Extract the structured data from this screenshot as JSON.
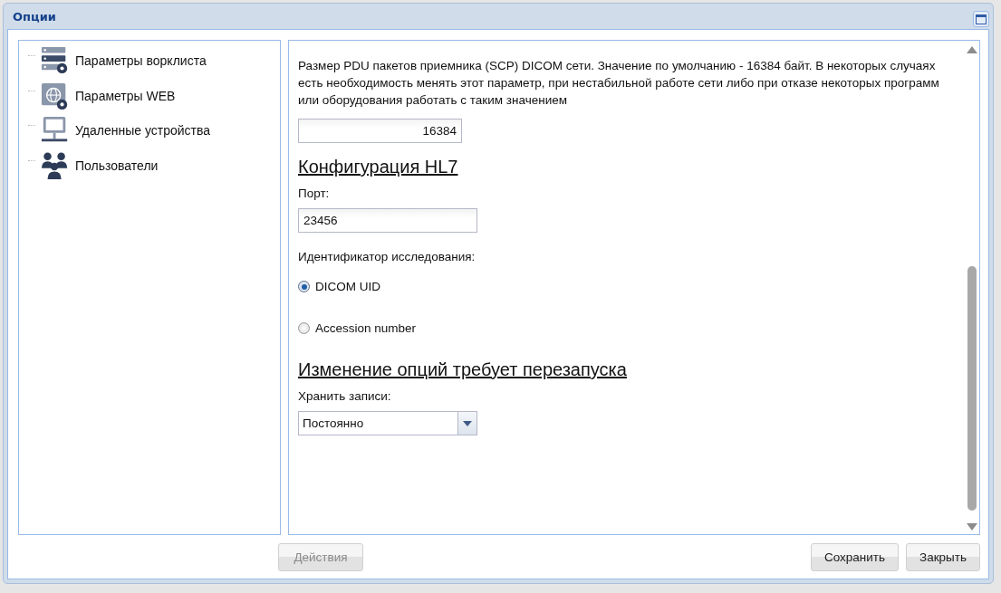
{
  "window": {
    "title": "Опции"
  },
  "tree": {
    "items": [
      {
        "label": "Параметры ворклиста"
      },
      {
        "label": "Параметры WEB"
      },
      {
        "label": "Удаленные устройства"
      },
      {
        "label": "Пользователи"
      }
    ]
  },
  "settings": {
    "description": "Размер PDU пакетов приемника (SCP) DICOM сети. Значение по умолчанию - 16384 байт. В некоторых случаях есть необходимость менять этот параметр, при нестабильной работе сети либо при отказе некоторых программ или оборудования работать с таким значением",
    "pdu_size": {
      "value": "16384"
    },
    "hl7_heading": "Конфигурация HL7",
    "port": {
      "label": "Порт:",
      "value": "23456"
    },
    "study_id": {
      "label": "Идентификатор исследования:",
      "options": [
        {
          "label": "DICOM UID",
          "selected": true
        },
        {
          "label": "Accession number",
          "selected": false
        }
      ]
    },
    "restart_heading": "Изменение опций требует перезапуска",
    "keep_records": {
      "label": "Хранить записи:",
      "value": "Постоянно"
    }
  },
  "buttons": [
    {
      "label": "Действия",
      "disabled": true
    },
    {
      "label": "Сохранить",
      "disabled": false
    },
    {
      "label": "Закрыть",
      "disabled": false
    }
  ]
}
